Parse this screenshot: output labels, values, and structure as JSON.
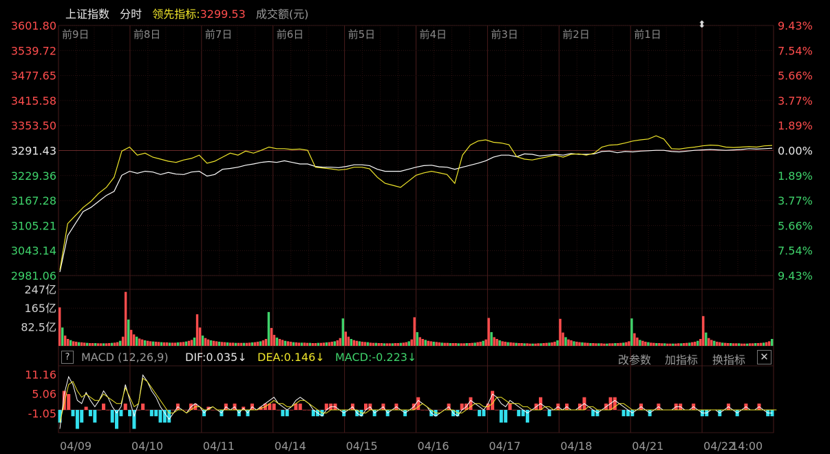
{
  "header": {
    "index_name": "上证指数",
    "mode": "分时",
    "leader_label": "领先指标:",
    "leader_value": "3299.53",
    "volume_label": "成交额(元)"
  },
  "macd_header": {
    "help": "?",
    "title": "MACD (12,26,9)",
    "dif": "DIF:0.035↓",
    "dea": "DEA:0.146↓",
    "macd": "MACD:-0.223↓",
    "btn_params": "改参数",
    "btn_add": "加指标",
    "btn_switch": "换指标",
    "close": "✕"
  },
  "colors": {
    "up": "#ff4d4d",
    "down": "#3fd36b",
    "price_line": "#ffffff",
    "leader_line": "#f0e62a",
    "macd_neg": "#33e0ee",
    "grid": "#3a1a1a",
    "axis_text_neutral": "#e8e8e8"
  },
  "chart_data": [
    {
      "type": "line",
      "name": "intraday-price",
      "day_labels": [
        "前9日",
        "前8日",
        "前7日",
        "前6日",
        "前5日",
        "前4日",
        "前3日",
        "前2日",
        "前1日"
      ],
      "left_ticks": [
        "3601.80",
        "3539.72",
        "3477.65",
        "3415.58",
        "3353.50",
        "3291.43",
        "3229.36",
        "3167.28",
        "3105.21",
        "3043.14",
        "2981.06"
      ],
      "right_ticks": [
        "9.43%",
        "7.54%",
        "5.66%",
        "3.77%",
        "1.89%",
        "0.00%",
        "1.89%",
        "3.77%",
        "5.66%",
        "7.54%",
        "9.43%"
      ],
      "ylim": [
        2981.06,
        3601.8
      ],
      "reference": 3291.43,
      "series": [
        {
          "role": "price",
          "values": [
            2990,
            3080,
            3110,
            3140,
            3150,
            3165,
            3180,
            3190,
            3230,
            3240,
            3235,
            3240,
            3238,
            3232,
            3237,
            3233,
            3232,
            3238,
            3240,
            3228,
            3232,
            3245,
            3247,
            3250,
            3255,
            3258,
            3262,
            3264,
            3262,
            3266,
            3262,
            3258,
            3258,
            3252,
            3250,
            3250,
            3249,
            3252,
            3256,
            3256,
            3254,
            3245,
            3240,
            3240,
            3240,
            3245,
            3250,
            3254,
            3255,
            3251,
            3250,
            3245,
            3250,
            3255,
            3260,
            3266,
            3275,
            3280,
            3280,
            3276,
            3283,
            3282,
            3278,
            3280,
            3282,
            3280,
            3284,
            3282,
            3282,
            3283,
            3289,
            3290,
            3286,
            3289,
            3288,
            3290,
            3291,
            3292,
            3292,
            3289,
            3288,
            3290,
            3292,
            3293,
            3294,
            3293,
            3292,
            3293,
            3294,
            3296,
            3295,
            3296,
            3297
          ]
        },
        {
          "role": "leader",
          "values": [
            2995,
            3110,
            3130,
            3150,
            3165,
            3185,
            3200,
            3225,
            3290,
            3300,
            3280,
            3285,
            3275,
            3270,
            3265,
            3262,
            3268,
            3272,
            3280,
            3260,
            3265,
            3275,
            3285,
            3280,
            3290,
            3285,
            3292,
            3300,
            3296,
            3296,
            3294,
            3295,
            3292,
            3250,
            3248,
            3246,
            3243,
            3245,
            3250,
            3250,
            3246,
            3225,
            3210,
            3205,
            3200,
            3215,
            3230,
            3236,
            3240,
            3236,
            3232,
            3210,
            3280,
            3305,
            3315,
            3318,
            3312,
            3310,
            3306,
            3276,
            3270,
            3268,
            3272,
            3276,
            3280,
            3275,
            3282,
            3283,
            3280,
            3285,
            3300,
            3305,
            3306,
            3310,
            3315,
            3318,
            3320,
            3328,
            3320,
            3296,
            3295,
            3298,
            3300,
            3303,
            3305,
            3304,
            3300,
            3299,
            3300,
            3301,
            3300,
            3303,
            3304
          ]
        }
      ]
    },
    {
      "type": "bar",
      "name": "turnover",
      "unit": "亿",
      "ticks": [
        "247亿",
        "165亿",
        "82.5亿"
      ],
      "ylim": [
        0,
        247
      ],
      "values": [
        168,
        80,
        45,
        30,
        25,
        20,
        18,
        16,
        15,
        14,
        13,
        12,
        12,
        12,
        11,
        11,
        11,
        11,
        12,
        13,
        14,
        16,
        22,
        40,
        236,
        115,
        70,
        50,
        40,
        32,
        28,
        24,
        22,
        20,
        19,
        18,
        17,
        16,
        15,
        15,
        14,
        14,
        14,
        15,
        16,
        17,
        19,
        22,
        26,
        36,
        138,
        80,
        45,
        34,
        28,
        24,
        22,
        20,
        18,
        17,
        16,
        15,
        14,
        14,
        13,
        13,
        13,
        13,
        13,
        14,
        15,
        16,
        18,
        20,
        24,
        30,
        148,
        78,
        48,
        36,
        30,
        26,
        22,
        20,
        18,
        16,
        15,
        14,
        14,
        14,
        13,
        13,
        12,
        12,
        13,
        13,
        14,
        15,
        16,
        18,
        20,
        24,
        34,
        120,
        62,
        40,
        30,
        25,
        22,
        20,
        18,
        17,
        16,
        14,
        13,
        13,
        12,
        12,
        11,
        11,
        11,
        11,
        12,
        12,
        13,
        14,
        16,
        20,
        28,
        125,
        60,
        38,
        30,
        26,
        22,
        20,
        18,
        17,
        15,
        14,
        13,
        13,
        12,
        12,
        12,
        11,
        11,
        11,
        12,
        12,
        13,
        14,
        16,
        18,
        22,
        28,
        122,
        60,
        38,
        30,
        24,
        20,
        18,
        16,
        15,
        14,
        13,
        12,
        12,
        11,
        11,
        10,
        10,
        10,
        11,
        11,
        12,
        13,
        14,
        15,
        18,
        24,
        118,
        58,
        38,
        28,
        24,
        20,
        18,
        16,
        15,
        14,
        13,
        12,
        12,
        11,
        11,
        11,
        10,
        10,
        11,
        11,
        12,
        12,
        13,
        14,
        16,
        20,
        120,
        55,
        36,
        26,
        22,
        18,
        16,
        14,
        13,
        12,
        12,
        11,
        11,
        10,
        10,
        10,
        10,
        11,
        11,
        12,
        13,
        14,
        16,
        18,
        22,
        30,
        130,
        58,
        34,
        26,
        22,
        18,
        16,
        14,
        13,
        12,
        12,
        11,
        11,
        11,
        10,
        10,
        10,
        11,
        11,
        12,
        12,
        13,
        14,
        16,
        20,
        30
      ]
    },
    {
      "type": "line",
      "name": "macd",
      "ticks": [
        "11.16",
        "5.06",
        "-1.05"
      ],
      "ylim": [
        -7.2,
        13.5
      ],
      "dif": [
        -6,
        5,
        10.5,
        8,
        3,
        2,
        5.5,
        3,
        1,
        3,
        6,
        4,
        1,
        -1,
        1,
        8,
        3,
        -2,
        2,
        11,
        9,
        6,
        4,
        1,
        -1,
        -3,
        -1,
        1,
        0,
        -1,
        1,
        2,
        1,
        -1,
        0.5,
        1,
        0,
        -1,
        1,
        0,
        1,
        -1,
        0.5,
        -1,
        1,
        0,
        1,
        2,
        3,
        4,
        2,
        1,
        0,
        1,
        3,
        4,
        3,
        2,
        0,
        -1,
        -2,
        0,
        1,
        1,
        0,
        -1,
        0,
        1,
        -1,
        -2,
        0,
        1,
        -1,
        0,
        1,
        -1,
        0,
        1,
        0,
        -1,
        0,
        1,
        3,
        2,
        1,
        -1,
        -2,
        -1,
        0,
        1,
        -1,
        -2,
        0,
        1,
        3,
        2,
        1,
        0,
        2,
        5,
        4,
        2,
        1,
        3,
        2,
        1,
        0,
        -1,
        0,
        1,
        2,
        1,
        0,
        0,
        1,
        0,
        1,
        0,
        0,
        1,
        2,
        1,
        0,
        -1,
        0,
        1,
        2,
        3,
        2,
        1,
        0,
        -1,
        0,
        1,
        0,
        -1,
        0,
        1,
        0,
        0,
        0,
        1,
        1,
        0,
        0,
        1,
        0,
        -1,
        -1,
        0,
        0,
        -1,
        0,
        1,
        0,
        -1,
        0,
        1,
        0,
        0,
        1,
        0,
        -1,
        -1
      ],
      "dea": [
        -4,
        2,
        8,
        9,
        6,
        4,
        5,
        4,
        3,
        3,
        5,
        4,
        3,
        2,
        2,
        7,
        4,
        1,
        2,
        10,
        9,
        7,
        5,
        3,
        1,
        -1,
        -1,
        0,
        0,
        -1,
        0,
        1,
        1,
        0,
        0,
        1,
        0,
        0,
        0,
        0,
        0,
        0,
        0,
        0,
        0,
        0,
        0.5,
        1,
        2,
        3,
        2,
        2,
        1,
        1,
        2,
        3,
        3,
        2,
        1,
        0,
        -1,
        -1,
        0,
        0,
        0,
        0,
        0,
        0,
        0,
        -1,
        -1,
        0,
        0,
        0,
        0,
        0,
        0,
        0,
        0,
        0,
        0,
        0,
        1,
        2,
        1,
        0,
        -1,
        -1,
        0,
        0,
        0,
        -1,
        -1,
        0,
        1,
        2,
        2,
        1,
        1,
        2,
        4,
        4,
        3,
        2,
        2,
        2,
        1,
        1,
        0,
        0,
        0,
        1,
        1,
        0,
        0,
        0,
        0,
        0,
        0,
        0,
        0,
        1,
        1,
        0,
        0,
        0,
        0,
        1,
        2,
        2,
        1,
        0,
        0,
        0,
        0,
        0,
        0,
        0,
        0,
        0,
        0,
        0,
        0,
        0,
        0,
        0,
        0,
        0,
        0,
        0,
        0,
        0,
        0,
        0,
        0,
        0,
        0,
        0,
        0,
        0,
        0,
        0,
        0,
        0,
        0
      ]
    }
  ],
  "x_labels": [
    "04/09",
    "04/10",
    "04/11",
    "04/14",
    "04/15",
    "04/16",
    "04/17",
    "04/18",
    "04/21",
    "04/22",
    "14:00"
  ]
}
